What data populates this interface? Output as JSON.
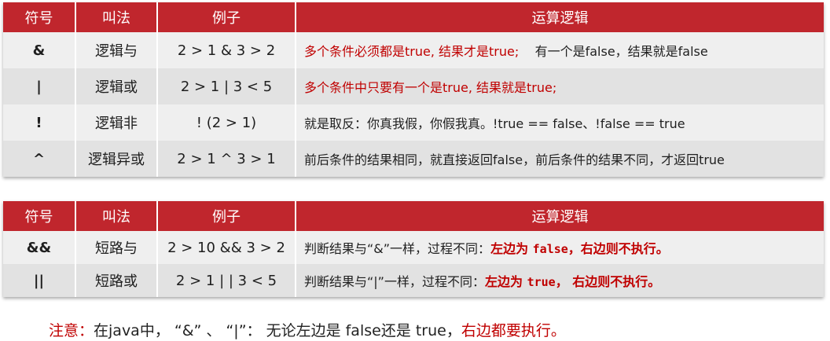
{
  "table1": {
    "headers": [
      "符号",
      "叫法",
      "例子",
      "运算逻辑"
    ],
    "rows": [
      {
        "symbol": "&",
        "name": "逻辑与",
        "example": "2 > 1 & 3 > 2",
        "logic_red": "多个条件必须都是true, 结果才是true;",
        "logic_black": "有一个是false，结果就是false"
      },
      {
        "symbol": "|",
        "name": "逻辑或",
        "example": "2 > 1 | 3 < 5",
        "logic_red": "多个条件中只要有一个是true, 结果就是true;",
        "logic_black": ""
      },
      {
        "symbol": "!",
        "name": "逻辑非",
        "example": "! (2 > 1)",
        "logic_red": "",
        "logic_black": "就是取反：你真我假，你假我真。!true == false、!false == true"
      },
      {
        "symbol": "^",
        "name": "逻辑异或",
        "example": "2 > 1 ^ 3 > 1",
        "logic_red": "",
        "logic_black": "前后条件的结果相同，就直接返回false，前后条件的结果不同，才返回true"
      }
    ]
  },
  "table2": {
    "headers": [
      "符号",
      "叫法",
      "例子",
      "运算逻辑"
    ],
    "rows": [
      {
        "symbol": "&&",
        "name": "短路与",
        "example": "2 > 10 && 3 > 2",
        "logic_prefix": "判断结果与“&”一样，过程不同：",
        "logic_red1": "左边为 ",
        "logic_mono": "false",
        "logic_red2": "，右边则不执行。"
      },
      {
        "symbol": "||",
        "name": "短路或",
        "example": "2 > 1 | | 3 < 5",
        "logic_prefix": "判断结果与“|”一样，过程不同：",
        "logic_red1": "左边为 ",
        "logic_mono": "true",
        "logic_red2": "，  右边则不执行。"
      }
    ]
  },
  "note": {
    "label": "注意：",
    "body": "在java中，  “&”  、 “|”： 无论左边是 false还是 true，",
    "emphasis": "右边都要执行。"
  },
  "colors": {
    "header_bg": "#c0262d",
    "row_light": "#efefef",
    "row_dark": "#e2e2e2",
    "accent_red": "#c00000"
  }
}
